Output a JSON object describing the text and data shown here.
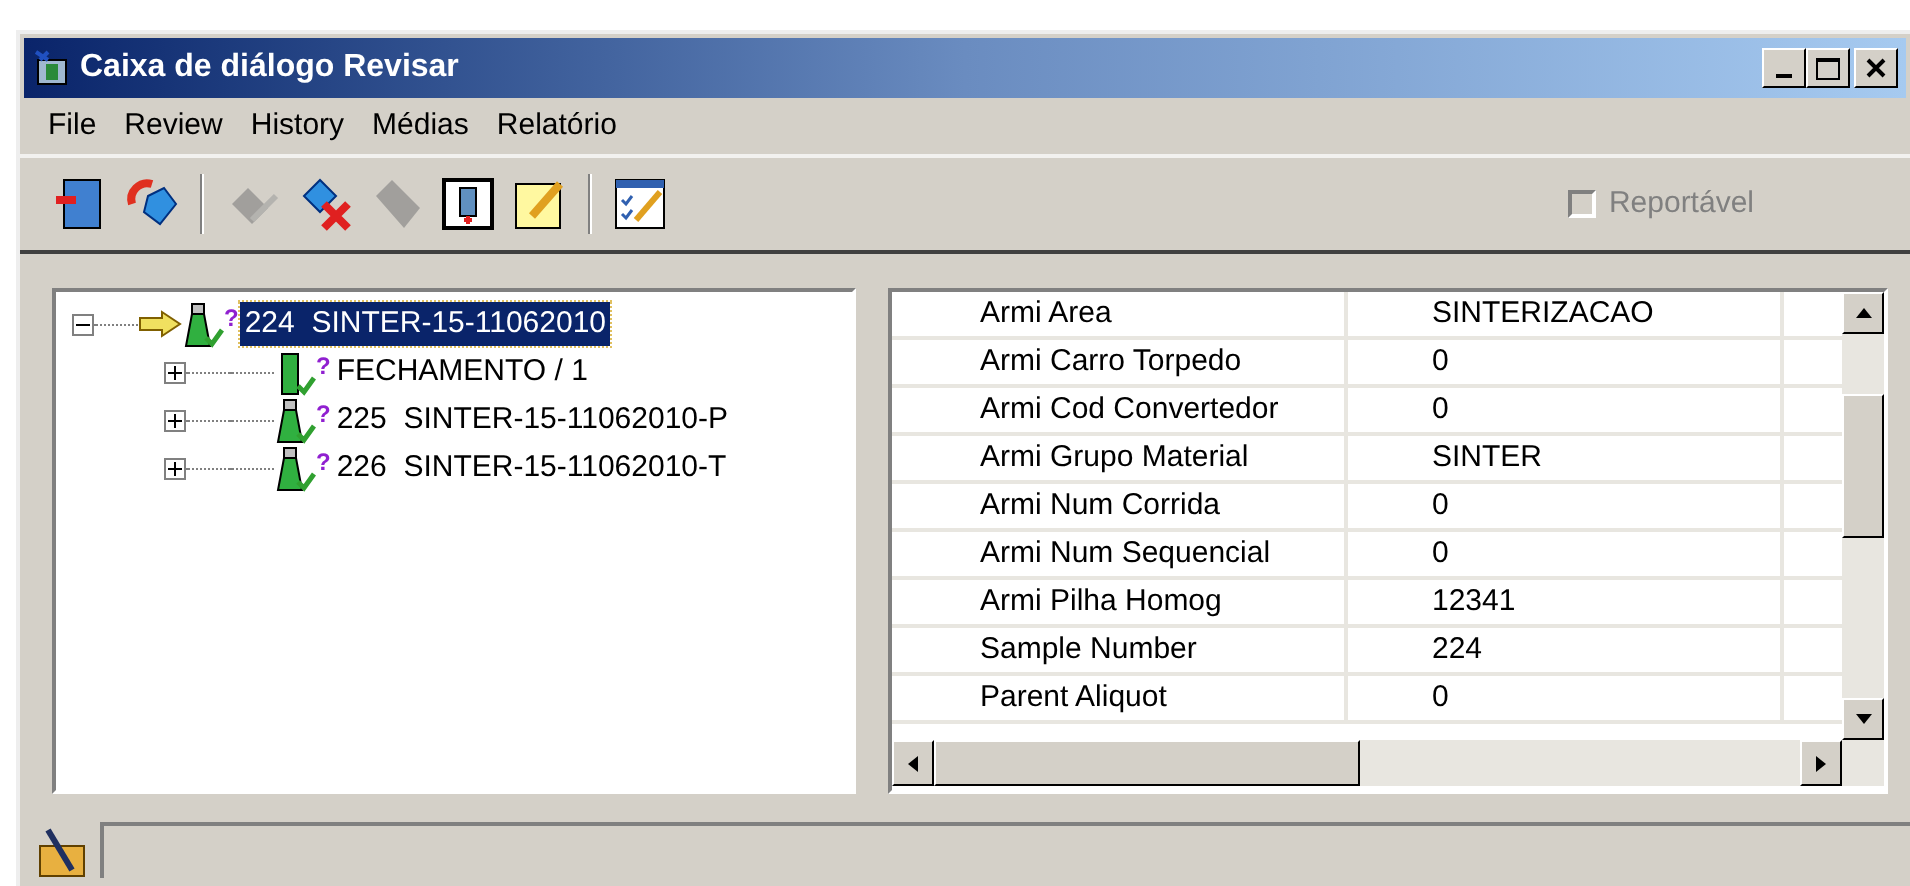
{
  "window": {
    "title": "Caixa de diálogo Revisar"
  },
  "menu": [
    "File",
    "Review",
    "History",
    "Médias",
    "Relatório"
  ],
  "toolbar": [
    {
      "kind": "exit",
      "disabled": false
    },
    {
      "kind": "refresh",
      "disabled": false
    },
    {
      "kind": "sep"
    },
    {
      "kind": "approve",
      "disabled": true
    },
    {
      "kind": "reject",
      "disabled": false
    },
    {
      "kind": "tag",
      "disabled": true
    },
    {
      "kind": "sample",
      "disabled": false
    },
    {
      "kind": "note",
      "disabled": false
    },
    {
      "kind": "sep"
    },
    {
      "kind": "checklist",
      "disabled": false
    }
  ],
  "reportable": {
    "label": "Reportável",
    "checked": false,
    "disabled": true
  },
  "tree": [
    {
      "label": "224  SINTER-15-11062010",
      "mark": "?",
      "kind": "sample",
      "selected": true,
      "current": true,
      "expanded": true,
      "children": [
        {
          "label": "FECHAMENTO / 1",
          "mark": "?",
          "kind": "tube",
          "selected": false,
          "current": false,
          "expanded": false
        },
        {
          "label": "225  SINTER-15-11062010-P",
          "mark": "?",
          "kind": "sample",
          "selected": false,
          "current": false,
          "expanded": false
        },
        {
          "label": "226  SINTER-15-11062010-T",
          "mark": "?",
          "kind": "sample",
          "selected": false,
          "current": false,
          "expanded": false
        }
      ]
    }
  ],
  "properties": [
    {
      "name": "Armi Area",
      "value": "SINTERIZACAO"
    },
    {
      "name": "Armi Carro Torpedo",
      "value": "0"
    },
    {
      "name": "Armi Cod Convertedor",
      "value": "0"
    },
    {
      "name": "Armi Grupo Material",
      "value": "SINTER"
    },
    {
      "name": "Armi Num Corrida",
      "value": "0"
    },
    {
      "name": "Armi Num Sequencial",
      "value": "0"
    },
    {
      "name": "Armi Pilha Homog",
      "value": "12341"
    },
    {
      "name": "Sample Number",
      "value": "224"
    },
    {
      "name": "Parent Aliquot",
      "value": "0"
    }
  ]
}
